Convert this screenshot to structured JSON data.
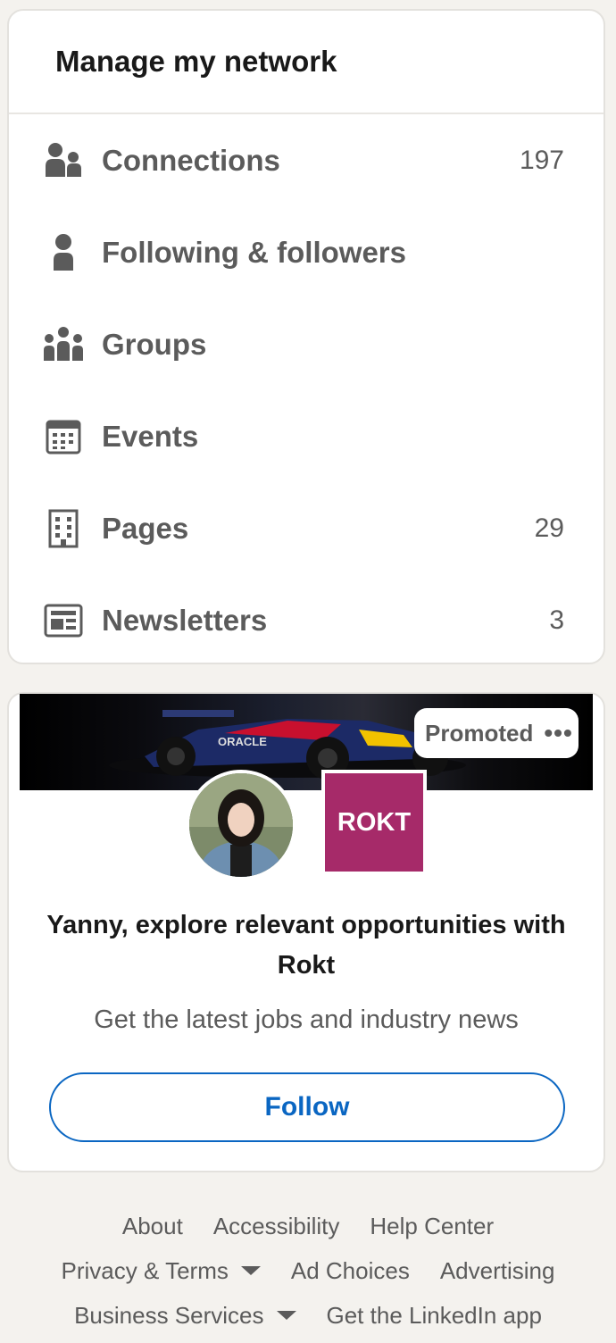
{
  "network": {
    "title": "Manage my network",
    "items": [
      {
        "label": "Connections",
        "count": "197",
        "icon": "people-icon"
      },
      {
        "label": "Following & followers",
        "count": "",
        "icon": "person-icon"
      },
      {
        "label": "Groups",
        "count": "",
        "icon": "group-icon"
      },
      {
        "label": "Events",
        "count": "",
        "icon": "calendar-icon"
      },
      {
        "label": "Pages",
        "count": "29",
        "icon": "building-icon"
      },
      {
        "label": "Newsletters",
        "count": "3",
        "icon": "newspaper-icon"
      }
    ]
  },
  "promo": {
    "promoted_label": "Promoted",
    "menu_dots": "•••",
    "company_logo_text": "ROKT",
    "headline": "Yanny, explore relevant opportunities with Rokt",
    "subline": "Get the latest jobs and industry news",
    "follow_label": "Follow",
    "brand_color": "#a62a69",
    "accent_color": "#0a66c2"
  },
  "footer": {
    "row1": [
      "About",
      "Accessibility",
      "Help Center"
    ],
    "row2": [
      "Privacy & Terms",
      "Ad Choices",
      "Advertising"
    ],
    "row3": [
      "Business Services",
      "Get the LinkedIn app"
    ]
  }
}
